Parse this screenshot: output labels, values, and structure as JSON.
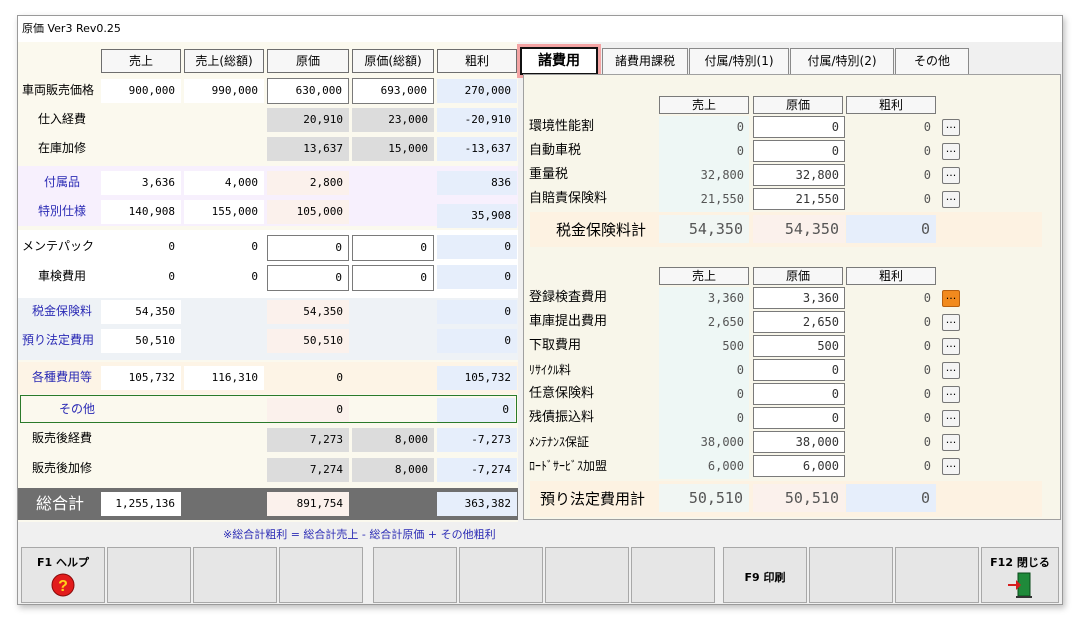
{
  "window": {
    "title": "原価 Ver3 Rev0.25"
  },
  "left": {
    "headers": [
      "売上",
      "売上(総額)",
      "原価",
      "原価(総額)",
      "粗利"
    ],
    "rows": [
      {
        "label": "車両販売価格",
        "v": [
          "900,000",
          "990,000",
          "630,000",
          "693,000",
          "270,000"
        ]
      },
      {
        "label": "仕入経費",
        "v": [
          "",
          "",
          "20,910",
          "23,000",
          "-20,910"
        ]
      },
      {
        "label": "在庫加修",
        "v": [
          "",
          "",
          "13,637",
          "15,000",
          "-13,637"
        ]
      },
      {
        "label": "付属品",
        "v": [
          "3,636",
          "4,000",
          "2,800",
          "",
          "836"
        ]
      },
      {
        "label": "特別仕様",
        "v": [
          "140,908",
          "155,000",
          "105,000",
          "",
          "35,908"
        ]
      },
      {
        "label": "メンテパック",
        "v": [
          "0",
          "0",
          "0",
          "0",
          "0"
        ]
      },
      {
        "label": "車検費用",
        "v": [
          "0",
          "0",
          "0",
          "0",
          "0"
        ]
      },
      {
        "label": "税金保険料",
        "v": [
          "54,350",
          "",
          "54,350",
          "",
          "0"
        ]
      },
      {
        "label": "預り法定費用",
        "v": [
          "50,510",
          "",
          "50,510",
          "",
          "0"
        ]
      },
      {
        "label": "各種費用等",
        "v": [
          "105,732",
          "116,310",
          "0",
          "",
          "105,732"
        ]
      },
      {
        "label": "その他",
        "v": [
          "",
          "",
          "0",
          "",
          "0"
        ]
      },
      {
        "label": "販売後経費",
        "v": [
          "",
          "",
          "7,273",
          "8,000",
          "-7,273"
        ]
      },
      {
        "label": "販売後加修",
        "v": [
          "",
          "",
          "7,274",
          "8,000",
          "-7,274"
        ]
      }
    ],
    "total": {
      "label": "総合計",
      "sale": "1,255,136",
      "cost": "891,754",
      "gross": "363,382"
    },
    "note": "※総合計粗利 = 総合計売上 - 総合計原価 + その他粗利"
  },
  "tabs": [
    "諸費用",
    "諸費用課税",
    "付属/特別(1)",
    "付属/特別(2)",
    "その他"
  ],
  "right": {
    "headers": [
      "売上",
      "原価",
      "粗利"
    ],
    "section1": [
      {
        "label": "環境性能割",
        "sale": "0",
        "cost": "0",
        "gross": "0"
      },
      {
        "label": "自動車税",
        "sale": "0",
        "cost": "0",
        "gross": "0"
      },
      {
        "label": "重量税",
        "sale": "32,800",
        "cost": "32,800",
        "gross": "0"
      },
      {
        "label": "自賠責保険料",
        "sale": "21,550",
        "cost": "21,550",
        "gross": "0"
      }
    ],
    "sum1": {
      "label": "税金保険料計",
      "sale": "54,350",
      "cost": "54,350",
      "gross": "0"
    },
    "section2": [
      {
        "label": "登録検査費用",
        "sale": "3,360",
        "cost": "3,360",
        "gross": "0"
      },
      {
        "label": "車庫提出費用",
        "sale": "2,650",
        "cost": "2,650",
        "gross": "0"
      },
      {
        "label": "下取費用",
        "sale": "500",
        "cost": "500",
        "gross": "0"
      },
      {
        "label": "ﾘｻｲｸﾙ料",
        "sale": "0",
        "cost": "0",
        "gross": "0"
      },
      {
        "label": "任意保険料",
        "sale": "0",
        "cost": "0",
        "gross": "0"
      },
      {
        "label": "残債振込料",
        "sale": "0",
        "cost": "0",
        "gross": "0"
      },
      {
        "label": "ﾒﾝﾃﾅﾝｽ保証",
        "sale": "38,000",
        "cost": "38,000",
        "gross": "0"
      },
      {
        "label": "ﾛｰﾄﾞｻｰﾋﾞｽ加盟",
        "sale": "6,000",
        "cost": "6,000",
        "gross": "0"
      }
    ],
    "sum2": {
      "label": "預り法定費用計",
      "sale": "50,510",
      "cost": "50,510",
      "gross": "0"
    },
    "dots": "..."
  },
  "fkeys": {
    "f1": "F1 ヘルプ",
    "f9": "F9 印刷",
    "f12": "F12 閉じる"
  },
  "colors": {
    "active_tab_outline": "#f4a4a4",
    "highlight_button": "#f28a1e",
    "total_bar": "#6f6f6f"
  }
}
